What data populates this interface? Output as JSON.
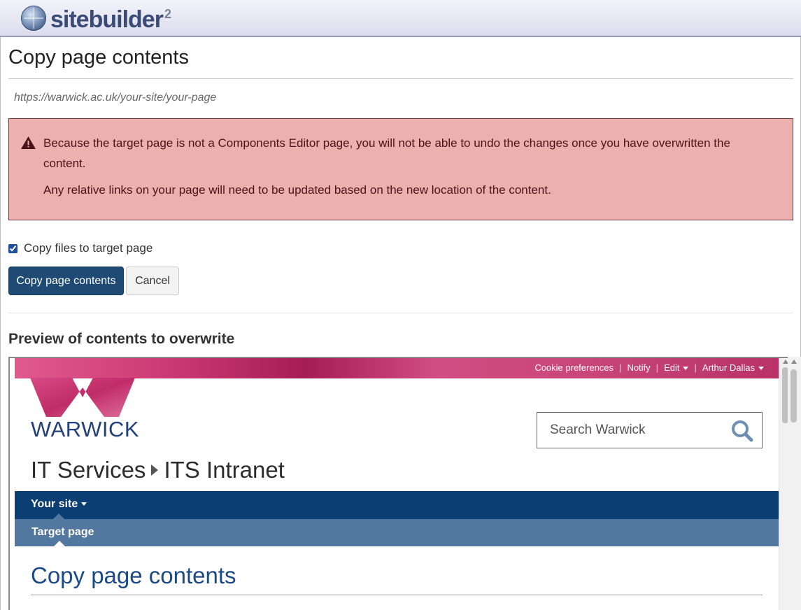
{
  "app": {
    "name": "sitebuilder",
    "version_mark": "2"
  },
  "page": {
    "title": "Copy page contents",
    "url": "https://warwick.ac.uk/your-site/your-page"
  },
  "alert": {
    "line1": "Because the target page is not a Components Editor page, you will not be able to undo the changes once you have overwritten the content.",
    "line2": "Any relative links on your page will need to be updated based on the new location of the content."
  },
  "form": {
    "copy_files_label": "Copy files to target page",
    "copy_files_checked": true,
    "submit_label": "Copy page contents",
    "cancel_label": "Cancel"
  },
  "preview": {
    "heading": "Preview of contents to overwrite",
    "utility_links": [
      "Cookie preferences",
      "Notify",
      "Edit",
      "Arthur Dallas"
    ],
    "brand": "WARWICK",
    "search_placeholder": "Search Warwick",
    "breadcrumb": [
      "IT Services",
      "ITS Intranet"
    ],
    "nav_primary": "Your site",
    "nav_secondary": "Target page",
    "content_title": "Copy page contents"
  },
  "colors": {
    "alert_bg": "#ecb0ae",
    "primary_button": "#1f4a74",
    "warwick_navy": "#0b3f73",
    "warwick_nav2": "#52789f",
    "warwick_pink": "#cc3a74"
  }
}
